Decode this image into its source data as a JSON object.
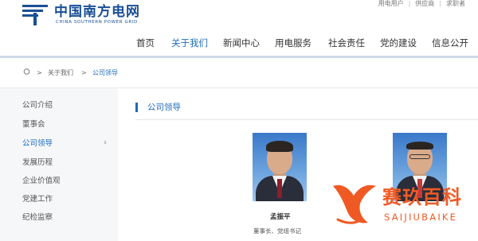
{
  "brand": {
    "name_cn": "中国南方电网",
    "name_en": "CHINA SOUTHERN POWER GRID",
    "color": "#1a4f95"
  },
  "top_links": [
    "用电用户",
    "供应商",
    "求职者"
  ],
  "nav": {
    "items": [
      "首页",
      "关于我们",
      "新闻中心",
      "用电服务",
      "社会责任",
      "党的建设",
      "信息公开"
    ],
    "active": "关于我们",
    "active_color": "#1d6bb8"
  },
  "breadcrumb": {
    "home_icon": "home-icon",
    "separator": ">",
    "items": [
      "关于我们",
      "公司领导"
    ]
  },
  "sidebar": {
    "items": [
      "公司介绍",
      "董事会",
      "公司领导",
      "发展历程",
      "企业价值观",
      "党建工作",
      "纪检监察"
    ],
    "active": "公司领导",
    "arrow": "›"
  },
  "section": {
    "title": "公司领导"
  },
  "leaders": [
    {
      "name": "孟振平",
      "title": "董事长、党组书记"
    },
    {
      "name": "",
      "title": ""
    }
  ],
  "watermark": {
    "text_cn": "赛玖百科",
    "text_en": "SAIJIUBAIKE",
    "color": "#ef5a24"
  }
}
